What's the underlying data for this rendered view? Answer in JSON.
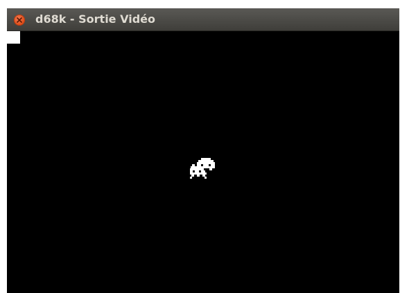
{
  "window": {
    "title": "d68k - Sortie Vidéo"
  },
  "titlebar": {
    "close_icon": "close-icon",
    "close_color": "#df4b16"
  },
  "video_output": {
    "background": "#000000",
    "foreground": "#ffffff"
  }
}
